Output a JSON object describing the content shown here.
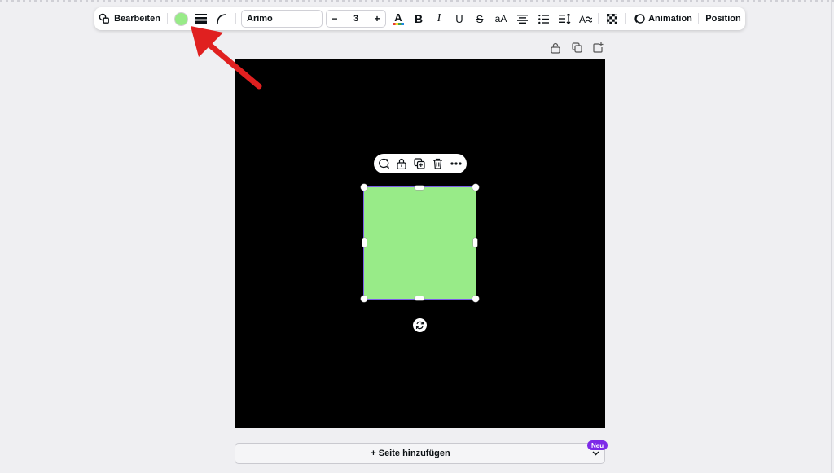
{
  "toolbar": {
    "edit_label": "Bearbeiten",
    "fill_color": "#98eb88",
    "font_name": "Arimo",
    "font_size": "3",
    "decrease_label": "−",
    "increase_label": "+",
    "case_label": "aA",
    "animation_label": "Animation",
    "position_label": "Position",
    "icons": [
      "shapes-icon",
      "line-weight-icon",
      "corner-radius-icon",
      "text-color-icon",
      "bold-icon",
      "italic-icon",
      "underline-icon",
      "strikethrough-icon",
      "align-center-icon",
      "list-icon",
      "spacing-icon",
      "effects-icon",
      "transparency-icon",
      "animation-icon"
    ]
  },
  "page_actions": {
    "icons": [
      "lock-icon",
      "duplicate-page-icon",
      "add-page-icon"
    ]
  },
  "canvas": {
    "background": "#000000",
    "shape_fill": "#98eb88",
    "selection_color": "#7b60e6"
  },
  "floating_bar": {
    "icons": [
      "comment-icon",
      "lock-icon",
      "duplicate-icon",
      "trash-icon",
      "more-icon"
    ]
  },
  "add_page": {
    "label": "+ Seite hinzufügen",
    "badge": "Neu"
  },
  "annotation": {
    "color": "#e02020"
  }
}
